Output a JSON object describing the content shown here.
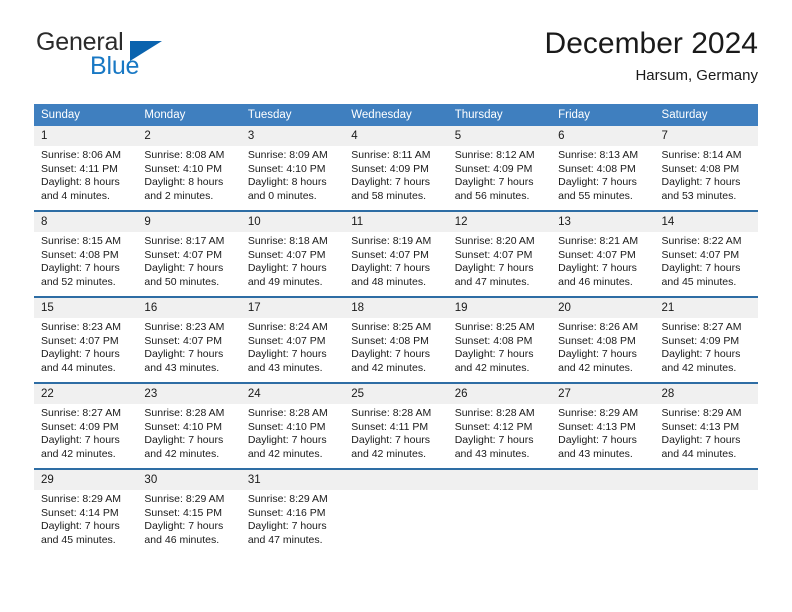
{
  "brand": {
    "name_primary": "General",
    "name_secondary": "Blue",
    "triangle_color": "#0a63ae",
    "blue_text_color": "#1878c4"
  },
  "header": {
    "title": "December 2024",
    "location": "Harsum, Germany",
    "header_bg_color": "#3f7fbf",
    "row_divider_color": "#2e6da4",
    "daynum_bg_color": "#f0f0f0"
  },
  "weekdays": [
    "Sunday",
    "Monday",
    "Tuesday",
    "Wednesday",
    "Thursday",
    "Friday",
    "Saturday"
  ],
  "weeks": [
    [
      {
        "day": "1",
        "sunrise": "Sunrise: 8:06 AM",
        "sunset": "Sunset: 4:11 PM",
        "daylight_1": "Daylight: 8 hours",
        "daylight_2": "and 4 minutes."
      },
      {
        "day": "2",
        "sunrise": "Sunrise: 8:08 AM",
        "sunset": "Sunset: 4:10 PM",
        "daylight_1": "Daylight: 8 hours",
        "daylight_2": "and 2 minutes."
      },
      {
        "day": "3",
        "sunrise": "Sunrise: 8:09 AM",
        "sunset": "Sunset: 4:10 PM",
        "daylight_1": "Daylight: 8 hours",
        "daylight_2": "and 0 minutes."
      },
      {
        "day": "4",
        "sunrise": "Sunrise: 8:11 AM",
        "sunset": "Sunset: 4:09 PM",
        "daylight_1": "Daylight: 7 hours",
        "daylight_2": "and 58 minutes."
      },
      {
        "day": "5",
        "sunrise": "Sunrise: 8:12 AM",
        "sunset": "Sunset: 4:09 PM",
        "daylight_1": "Daylight: 7 hours",
        "daylight_2": "and 56 minutes."
      },
      {
        "day": "6",
        "sunrise": "Sunrise: 8:13 AM",
        "sunset": "Sunset: 4:08 PM",
        "daylight_1": "Daylight: 7 hours",
        "daylight_2": "and 55 minutes."
      },
      {
        "day": "7",
        "sunrise": "Sunrise: 8:14 AM",
        "sunset": "Sunset: 4:08 PM",
        "daylight_1": "Daylight: 7 hours",
        "daylight_2": "and 53 minutes."
      }
    ],
    [
      {
        "day": "8",
        "sunrise": "Sunrise: 8:15 AM",
        "sunset": "Sunset: 4:08 PM",
        "daylight_1": "Daylight: 7 hours",
        "daylight_2": "and 52 minutes."
      },
      {
        "day": "9",
        "sunrise": "Sunrise: 8:17 AM",
        "sunset": "Sunset: 4:07 PM",
        "daylight_1": "Daylight: 7 hours",
        "daylight_2": "and 50 minutes."
      },
      {
        "day": "10",
        "sunrise": "Sunrise: 8:18 AM",
        "sunset": "Sunset: 4:07 PM",
        "daylight_1": "Daylight: 7 hours",
        "daylight_2": "and 49 minutes."
      },
      {
        "day": "11",
        "sunrise": "Sunrise: 8:19 AM",
        "sunset": "Sunset: 4:07 PM",
        "daylight_1": "Daylight: 7 hours",
        "daylight_2": "and 48 minutes."
      },
      {
        "day": "12",
        "sunrise": "Sunrise: 8:20 AM",
        "sunset": "Sunset: 4:07 PM",
        "daylight_1": "Daylight: 7 hours",
        "daylight_2": "and 47 minutes."
      },
      {
        "day": "13",
        "sunrise": "Sunrise: 8:21 AM",
        "sunset": "Sunset: 4:07 PM",
        "daylight_1": "Daylight: 7 hours",
        "daylight_2": "and 46 minutes."
      },
      {
        "day": "14",
        "sunrise": "Sunrise: 8:22 AM",
        "sunset": "Sunset: 4:07 PM",
        "daylight_1": "Daylight: 7 hours",
        "daylight_2": "and 45 minutes."
      }
    ],
    [
      {
        "day": "15",
        "sunrise": "Sunrise: 8:23 AM",
        "sunset": "Sunset: 4:07 PM",
        "daylight_1": "Daylight: 7 hours",
        "daylight_2": "and 44 minutes."
      },
      {
        "day": "16",
        "sunrise": "Sunrise: 8:23 AM",
        "sunset": "Sunset: 4:07 PM",
        "daylight_1": "Daylight: 7 hours",
        "daylight_2": "and 43 minutes."
      },
      {
        "day": "17",
        "sunrise": "Sunrise: 8:24 AM",
        "sunset": "Sunset: 4:07 PM",
        "daylight_1": "Daylight: 7 hours",
        "daylight_2": "and 43 minutes."
      },
      {
        "day": "18",
        "sunrise": "Sunrise: 8:25 AM",
        "sunset": "Sunset: 4:08 PM",
        "daylight_1": "Daylight: 7 hours",
        "daylight_2": "and 42 minutes."
      },
      {
        "day": "19",
        "sunrise": "Sunrise: 8:25 AM",
        "sunset": "Sunset: 4:08 PM",
        "daylight_1": "Daylight: 7 hours",
        "daylight_2": "and 42 minutes."
      },
      {
        "day": "20",
        "sunrise": "Sunrise: 8:26 AM",
        "sunset": "Sunset: 4:08 PM",
        "daylight_1": "Daylight: 7 hours",
        "daylight_2": "and 42 minutes."
      },
      {
        "day": "21",
        "sunrise": "Sunrise: 8:27 AM",
        "sunset": "Sunset: 4:09 PM",
        "daylight_1": "Daylight: 7 hours",
        "daylight_2": "and 42 minutes."
      }
    ],
    [
      {
        "day": "22",
        "sunrise": "Sunrise: 8:27 AM",
        "sunset": "Sunset: 4:09 PM",
        "daylight_1": "Daylight: 7 hours",
        "daylight_2": "and 42 minutes."
      },
      {
        "day": "23",
        "sunrise": "Sunrise: 8:28 AM",
        "sunset": "Sunset: 4:10 PM",
        "daylight_1": "Daylight: 7 hours",
        "daylight_2": "and 42 minutes."
      },
      {
        "day": "24",
        "sunrise": "Sunrise: 8:28 AM",
        "sunset": "Sunset: 4:10 PM",
        "daylight_1": "Daylight: 7 hours",
        "daylight_2": "and 42 minutes."
      },
      {
        "day": "25",
        "sunrise": "Sunrise: 8:28 AM",
        "sunset": "Sunset: 4:11 PM",
        "daylight_1": "Daylight: 7 hours",
        "daylight_2": "and 42 minutes."
      },
      {
        "day": "26",
        "sunrise": "Sunrise: 8:28 AM",
        "sunset": "Sunset: 4:12 PM",
        "daylight_1": "Daylight: 7 hours",
        "daylight_2": "and 43 minutes."
      },
      {
        "day": "27",
        "sunrise": "Sunrise: 8:29 AM",
        "sunset": "Sunset: 4:13 PM",
        "daylight_1": "Daylight: 7 hours",
        "daylight_2": "and 43 minutes."
      },
      {
        "day": "28",
        "sunrise": "Sunrise: 8:29 AM",
        "sunset": "Sunset: 4:13 PM",
        "daylight_1": "Daylight: 7 hours",
        "daylight_2": "and 44 minutes."
      }
    ],
    [
      {
        "day": "29",
        "sunrise": "Sunrise: 8:29 AM",
        "sunset": "Sunset: 4:14 PM",
        "daylight_1": "Daylight: 7 hours",
        "daylight_2": "and 45 minutes."
      },
      {
        "day": "30",
        "sunrise": "Sunrise: 8:29 AM",
        "sunset": "Sunset: 4:15 PM",
        "daylight_1": "Daylight: 7 hours",
        "daylight_2": "and 46 minutes."
      },
      {
        "day": "31",
        "sunrise": "Sunrise: 8:29 AM",
        "sunset": "Sunset: 4:16 PM",
        "daylight_1": "Daylight: 7 hours",
        "daylight_2": "and 47 minutes."
      },
      {
        "day": "",
        "sunrise": "",
        "sunset": "",
        "daylight_1": "",
        "daylight_2": ""
      },
      {
        "day": "",
        "sunrise": "",
        "sunset": "",
        "daylight_1": "",
        "daylight_2": ""
      },
      {
        "day": "",
        "sunrise": "",
        "sunset": "",
        "daylight_1": "",
        "daylight_2": ""
      },
      {
        "day": "",
        "sunrise": "",
        "sunset": "",
        "daylight_1": "",
        "daylight_2": ""
      }
    ]
  ]
}
